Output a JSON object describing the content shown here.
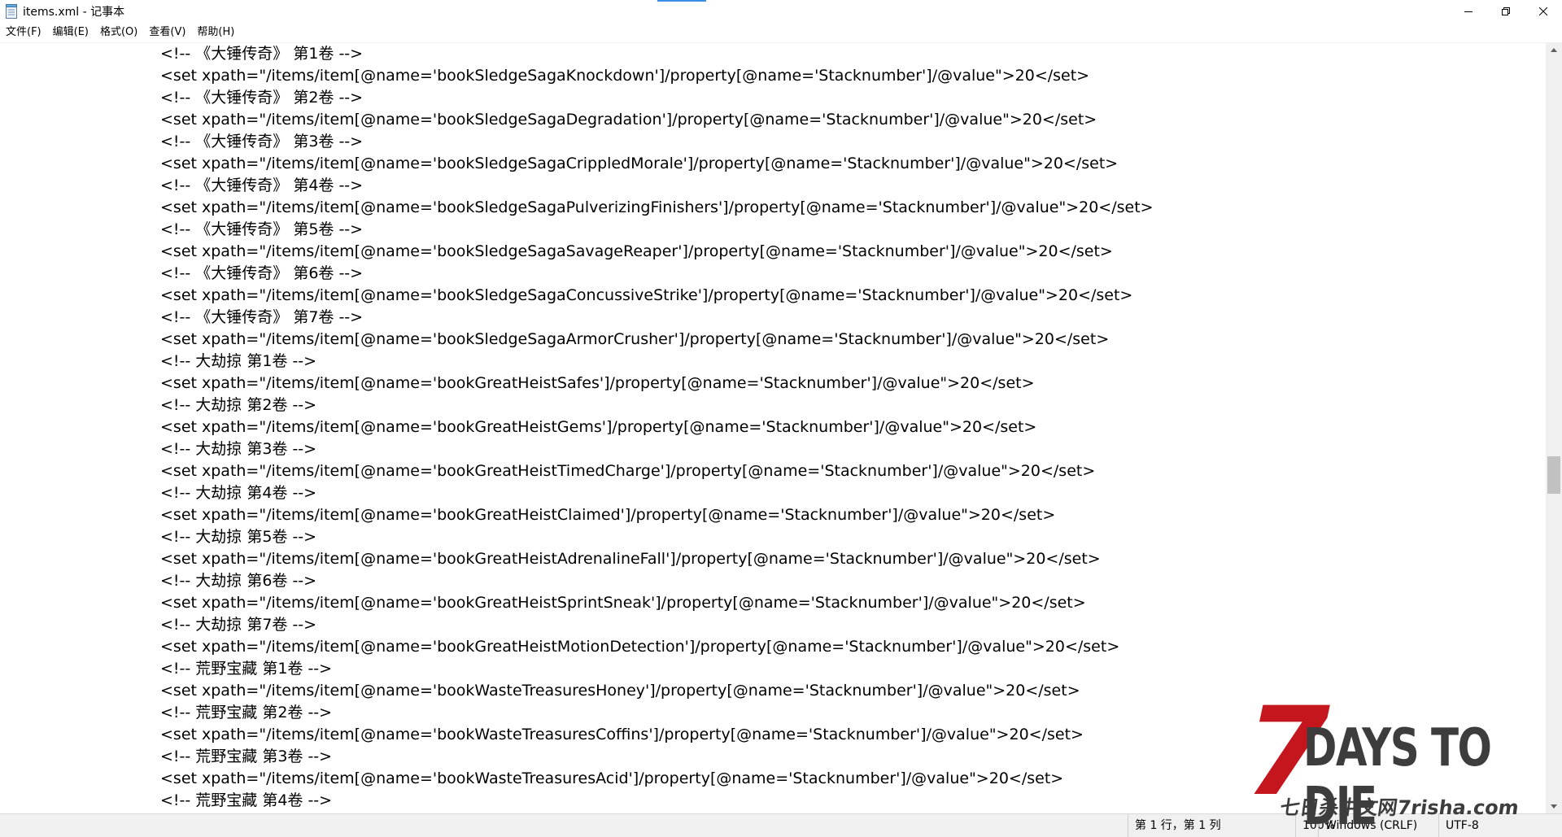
{
  "window": {
    "title": "items.xml - 记事本"
  },
  "menu": [
    "文件(F)",
    "编辑(E)",
    "格式(O)",
    "查看(V)",
    "帮助(H)"
  ],
  "lines": [
    "<!-- 《大锤传奇》 第1卷 -->",
    "<set xpath=\"/items/item[@name='bookSledgeSagaKnockdown']/property[@name='Stacknumber']/@value\">20</set>",
    "<!-- 《大锤传奇》 第2卷 -->",
    "<set xpath=\"/items/item[@name='bookSledgeSagaDegradation']/property[@name='Stacknumber']/@value\">20</set>",
    "<!-- 《大锤传奇》 第3卷 -->",
    "<set xpath=\"/items/item[@name='bookSledgeSagaCrippledMorale']/property[@name='Stacknumber']/@value\">20</set>",
    "<!-- 《大锤传奇》 第4卷 -->",
    "<set xpath=\"/items/item[@name='bookSledgeSagaPulverizingFinishers']/property[@name='Stacknumber']/@value\">20</set>",
    "<!-- 《大锤传奇》 第5卷 -->",
    "<set xpath=\"/items/item[@name='bookSledgeSagaSavageReaper']/property[@name='Stacknumber']/@value\">20</set>",
    "<!-- 《大锤传奇》 第6卷 -->",
    "<set xpath=\"/items/item[@name='bookSledgeSagaConcussiveStrike']/property[@name='Stacknumber']/@value\">20</set>",
    "<!-- 《大锤传奇》 第7卷 -->",
    "<set xpath=\"/items/item[@name='bookSledgeSagaArmorCrusher']/property[@name='Stacknumber']/@value\">20</set>",
    "<!-- 大劫掠 第1卷 -->",
    "<set xpath=\"/items/item[@name='bookGreatHeistSafes']/property[@name='Stacknumber']/@value\">20</set>",
    "<!-- 大劫掠 第2卷 -->",
    "<set xpath=\"/items/item[@name='bookGreatHeistGems']/property[@name='Stacknumber']/@value\">20</set>",
    "<!-- 大劫掠 第3卷 -->",
    "<set xpath=\"/items/item[@name='bookGreatHeistTimedCharge']/property[@name='Stacknumber']/@value\">20</set>",
    "<!-- 大劫掠 第4卷 -->",
    "<set xpath=\"/items/item[@name='bookGreatHeistClaimed']/property[@name='Stacknumber']/@value\">20</set>",
    "<!-- 大劫掠 第5卷 -->",
    "<set xpath=\"/items/item[@name='bookGreatHeistAdrenalineFall']/property[@name='Stacknumber']/@value\">20</set>",
    "<!-- 大劫掠 第6卷 -->",
    "<set xpath=\"/items/item[@name='bookGreatHeistSprintSneak']/property[@name='Stacknumber']/@value\">20</set>",
    "<!-- 大劫掠 第7卷 -->",
    "<set xpath=\"/items/item[@name='bookGreatHeistMotionDetection']/property[@name='Stacknumber']/@value\">20</set>",
    "<!-- 荒野宝藏 第1卷 -->",
    "<set xpath=\"/items/item[@name='bookWasteTreasuresHoney']/property[@name='Stacknumber']/@value\">20</set>",
    "<!-- 荒野宝藏 第2卷 -->",
    "<set xpath=\"/items/item[@name='bookWasteTreasuresCoffins']/property[@name='Stacknumber']/@value\">20</set>",
    "<!-- 荒野宝藏 第3卷 -->",
    "<set xpath=\"/items/item[@name='bookWasteTreasuresAcid']/property[@name='Stacknumber']/@value\">20</set>",
    "<!-- 荒野宝藏 第4卷 -->"
  ],
  "status": {
    "position": "第 1 行，第 1 列",
    "zoom": "100%",
    "line_ending": "Windows (CRLF)",
    "encoding": "UTF-8"
  },
  "watermark": {
    "number": "7",
    "title": "DAYS TO DIE",
    "subtitle": "七日杀中文网7risha.com"
  },
  "icons": {
    "app": "notepad-icon",
    "minimize": "minimize-icon",
    "restore": "restore-icon",
    "close": "close-icon"
  },
  "colors": {
    "watermark_red": "#c4161c",
    "watermark_gray": "#3d3d3d",
    "statusbar_bg": "#f0f0f0",
    "scroll_thumb": "#c1c1c1"
  }
}
